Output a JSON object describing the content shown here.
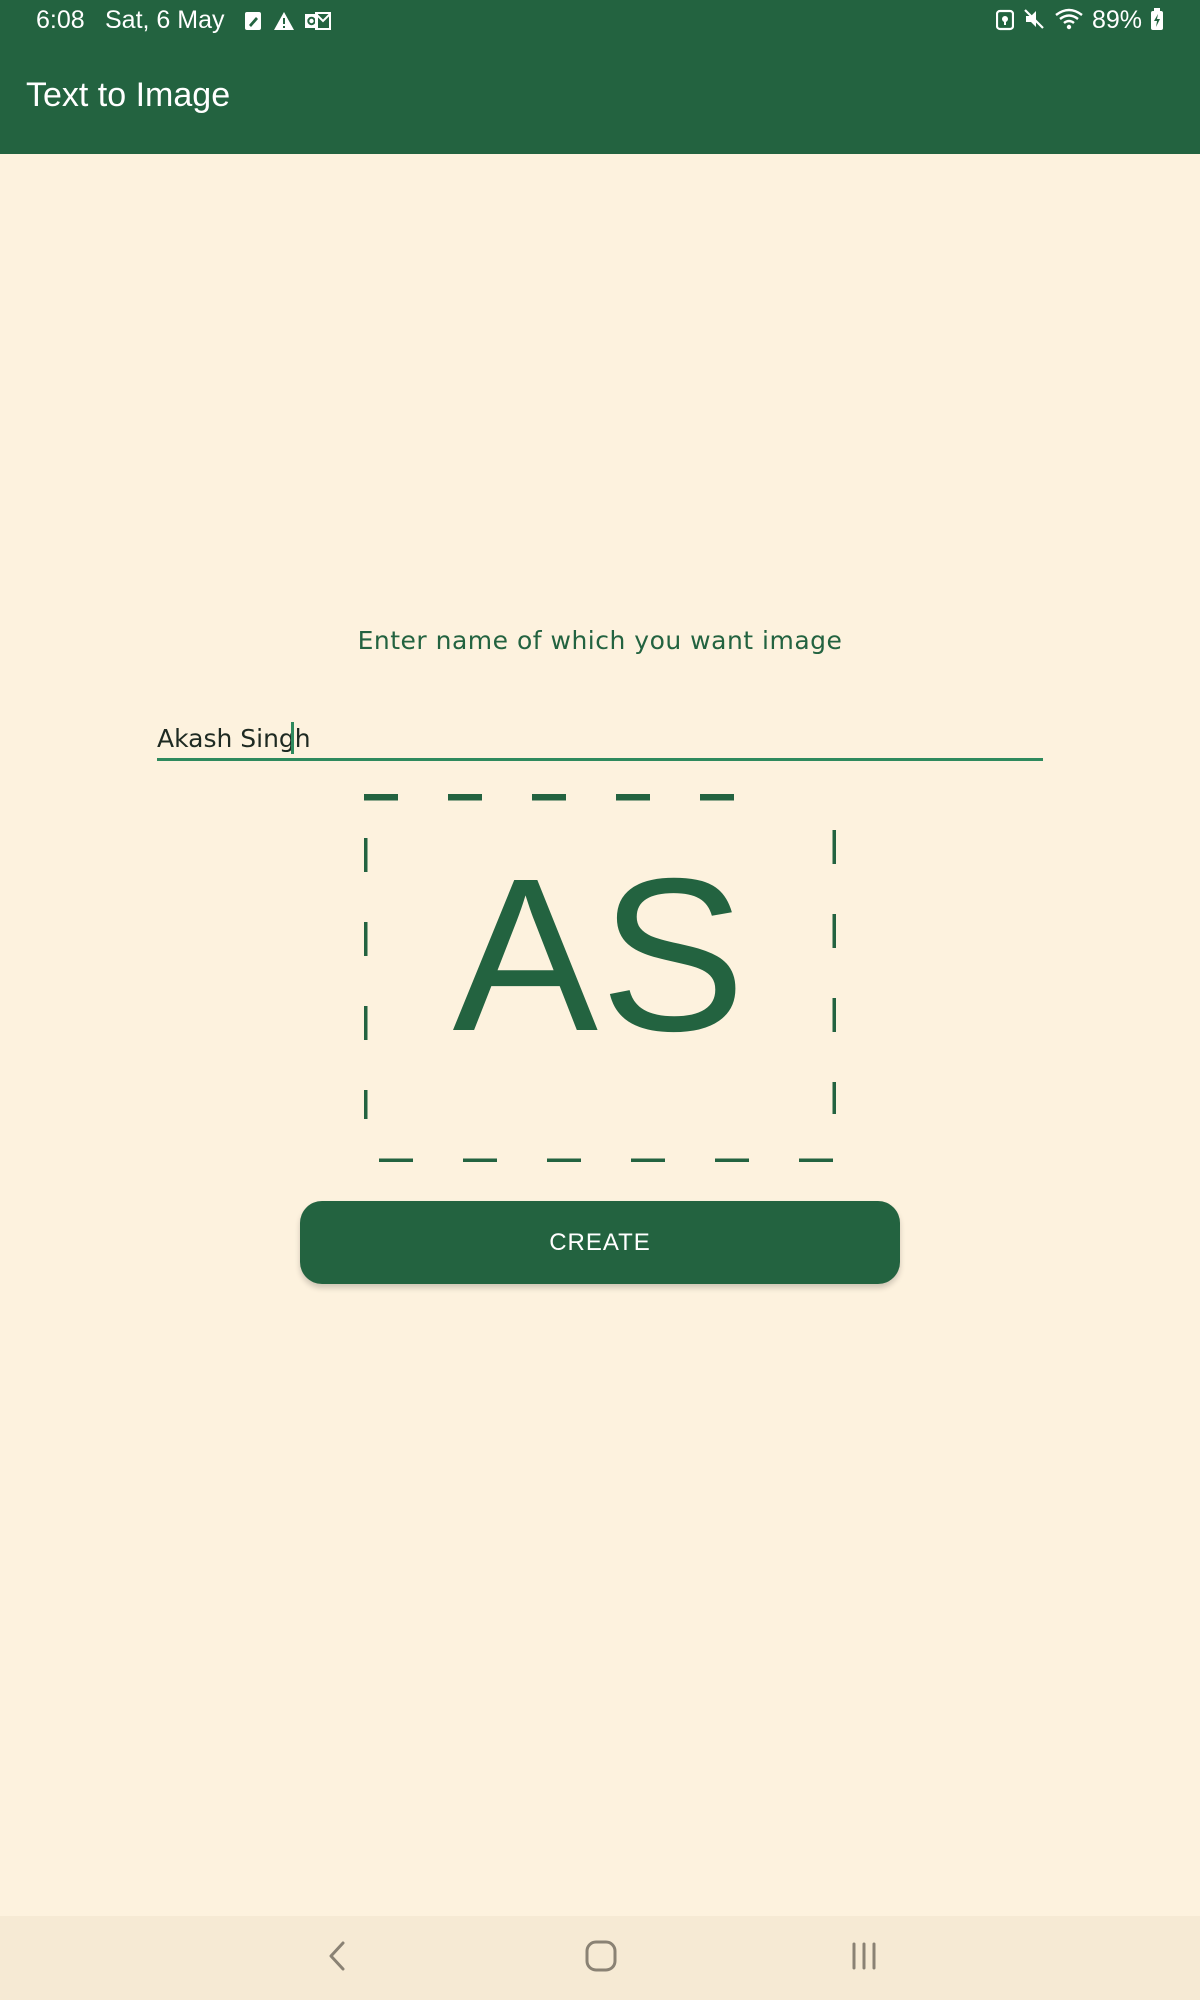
{
  "status_bar": {
    "time": "6:08",
    "date": "Sat, 6 May",
    "battery": "89%",
    "notification_icons": [
      "edit-note-icon",
      "warning-icon",
      "outlook-mail-icon"
    ],
    "system_icons": [
      "vpn-key-icon",
      "mute-icon",
      "wifi-icon",
      "battery-charging-icon"
    ]
  },
  "header": {
    "title": "Text to Image"
  },
  "main": {
    "prompt": "Enter name of which you want image",
    "name_input": {
      "value": "Akash Singh",
      "placeholder": ""
    },
    "preview_initials": "AS",
    "create_button": "CREATE"
  },
  "nav_bar": {
    "buttons": [
      "back-icon",
      "home-icon",
      "recents-icon"
    ]
  },
  "colors": {
    "primary": "#236340",
    "background": "#fdf2de",
    "accent_underline": "#2e8a5d",
    "nav_background": "#f6ead4"
  }
}
